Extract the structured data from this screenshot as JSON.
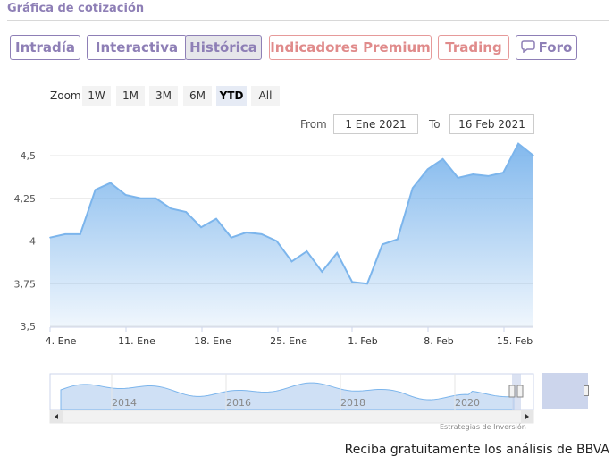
{
  "header": {
    "title": "Gráfica de cotización"
  },
  "tabs": [
    {
      "label": "Intradía"
    },
    {
      "label": "Interactiva"
    },
    {
      "label": "Histórica"
    },
    {
      "label": "Indicadores Premium"
    },
    {
      "label": "Trading"
    },
    {
      "label": "Foro",
      "icon": "chat-bubble-icon"
    }
  ],
  "zoom": {
    "label": "Zoom",
    "buttons": [
      "1W",
      "1M",
      "3M",
      "6M",
      "YTD",
      "All"
    ],
    "active": "YTD"
  },
  "range": {
    "from_label": "From",
    "from_value": "1 Ene 2021",
    "to_label": "To",
    "to_value": "16 Feb 2021"
  },
  "colors": {
    "accent": "#8e7fb6",
    "premium": "#e08b8b",
    "series": "#7cb5ec"
  },
  "chart_data": {
    "type": "area",
    "ylim": [
      3.5,
      4.5
    ],
    "y_ticks": [
      "4,5",
      "4,25",
      "4",
      "3,75",
      "3,5"
    ],
    "x_ticks": [
      "4. Ene",
      "11. Ene",
      "18. Ene",
      "25. Ene",
      "1. Feb",
      "8. Feb",
      "15. Feb"
    ],
    "x": [
      "2021-01-04",
      "2021-01-05",
      "2021-01-06",
      "2021-01-07",
      "2021-01-08",
      "2021-01-11",
      "2021-01-12",
      "2021-01-13",
      "2021-01-14",
      "2021-01-15",
      "2021-01-18",
      "2021-01-19",
      "2021-01-20",
      "2021-01-21",
      "2021-01-22",
      "2021-01-25",
      "2021-01-26",
      "2021-01-27",
      "2021-01-28",
      "2021-01-29",
      "2021-02-01",
      "2021-02-02",
      "2021-02-03",
      "2021-02-04",
      "2021-02-05",
      "2021-02-08",
      "2021-02-09",
      "2021-02-10",
      "2021-02-11",
      "2021-02-12",
      "2021-02-15",
      "2021-02-16"
    ],
    "values": [
      4.02,
      4.04,
      4.04,
      4.3,
      4.34,
      4.27,
      4.25,
      4.25,
      4.19,
      4.17,
      4.08,
      4.13,
      4.02,
      4.05,
      4.04,
      4.0,
      3.88,
      3.94,
      3.82,
      3.93,
      3.76,
      3.75,
      3.98,
      4.01,
      4.31,
      4.42,
      4.48,
      4.37,
      4.39,
      4.38,
      4.4,
      4.57,
      4.5
    ]
  },
  "navigator": {
    "years": [
      "2014",
      "2016",
      "2018",
      "2020"
    ]
  },
  "credits": "Estrategias de Inversión",
  "footer": {
    "text": "Reciba gratuitamente los análisis de BBVA"
  }
}
